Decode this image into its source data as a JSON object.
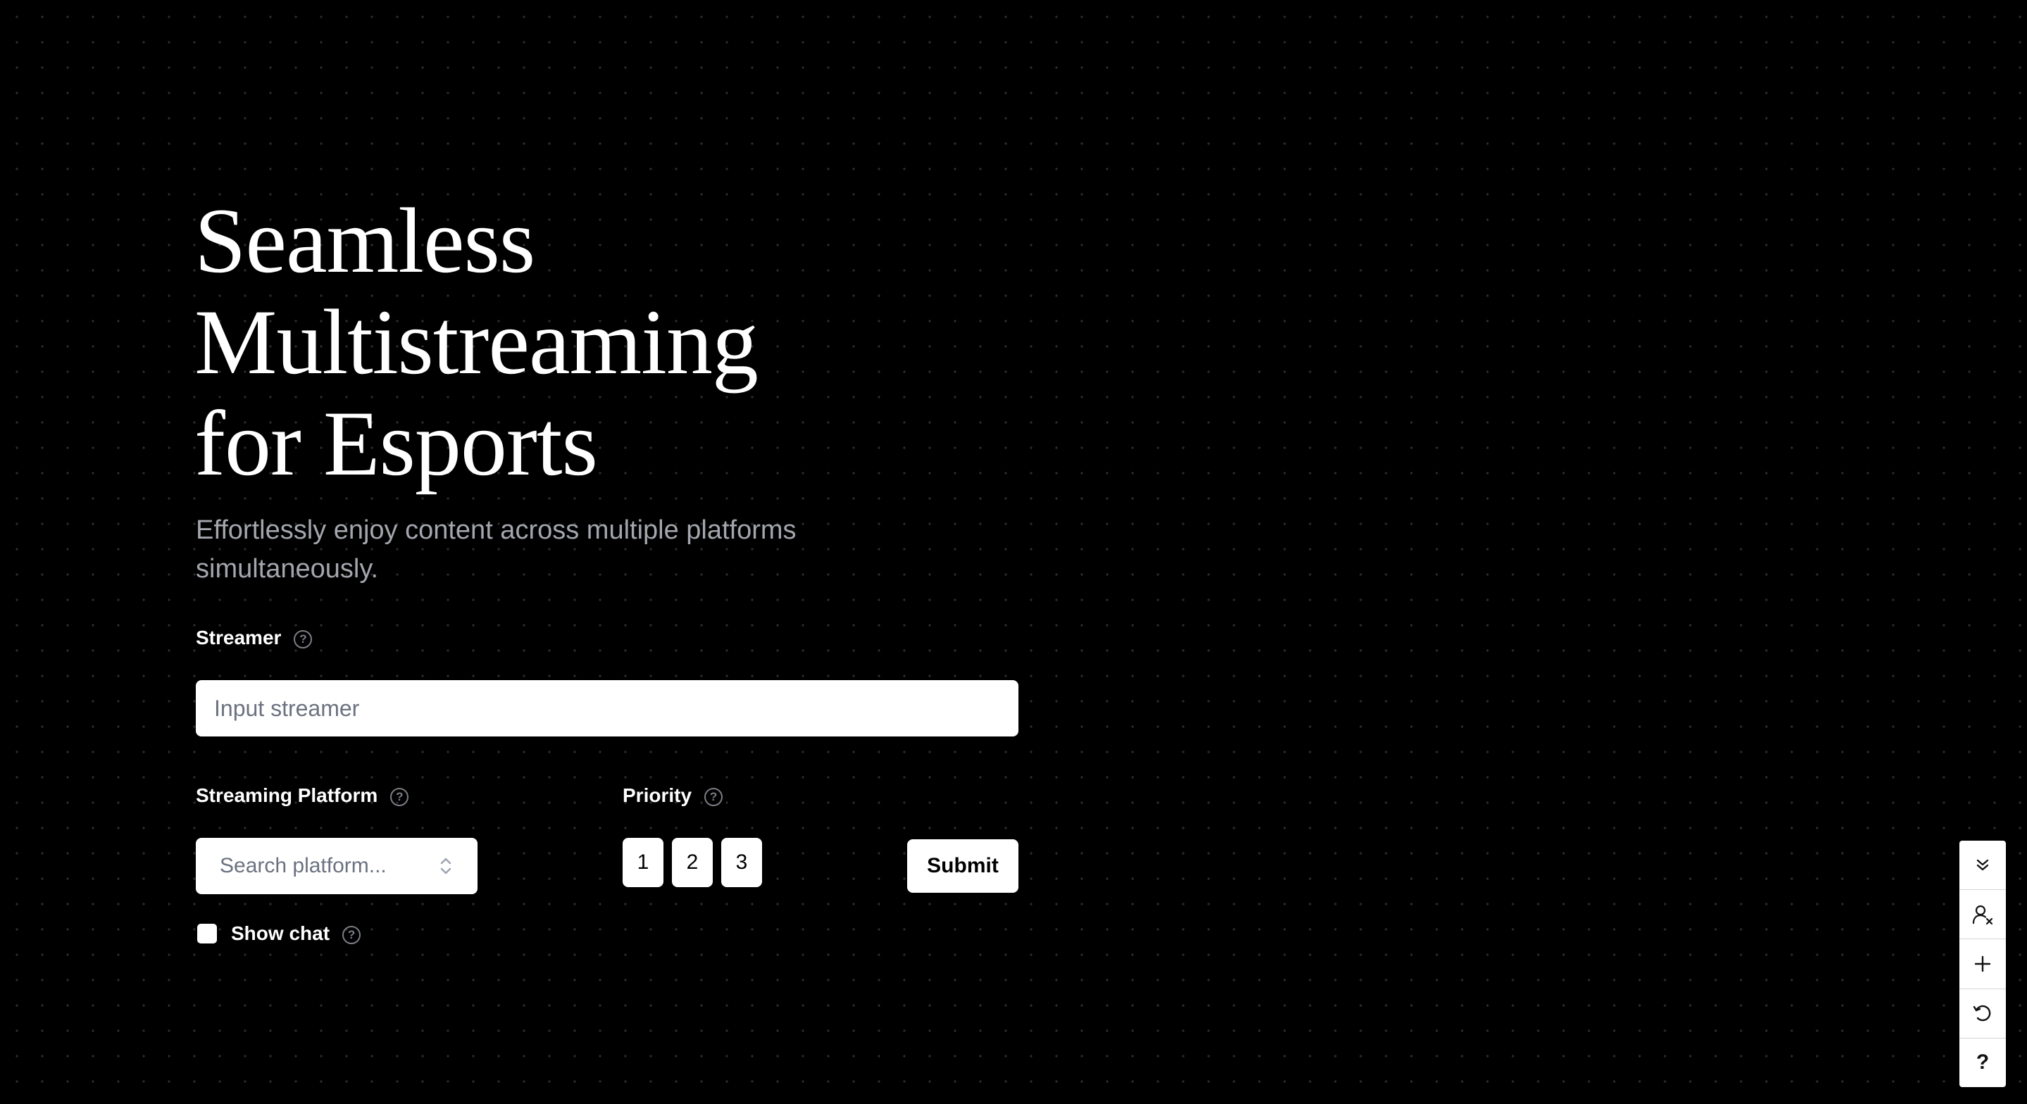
{
  "hero": {
    "title_lines": [
      "Seamless",
      "Multistreaming",
      "for Esports"
    ],
    "subtitle": "Effortlessly enjoy content across multiple platforms simultaneously."
  },
  "form": {
    "streamer": {
      "label": "Streamer",
      "placeholder": "Input streamer"
    },
    "platform": {
      "label": "Streaming Platform",
      "placeholder": "Search platform..."
    },
    "priority": {
      "label": "Priority",
      "options": [
        "1",
        "2",
        "3"
      ]
    },
    "submit_label": "Submit",
    "show_chat": {
      "label": "Show chat",
      "checked": false
    }
  },
  "toolbar": {
    "items": [
      "collapse-icon",
      "remove-user-icon",
      "plus-icon",
      "reset-icon",
      "help-icon"
    ],
    "help_glyph": "?"
  },
  "colors": {
    "background": "#000000",
    "text": "#ffffff",
    "subtitle": "#a3a6ad",
    "muted_icon": "#7b7e85"
  }
}
